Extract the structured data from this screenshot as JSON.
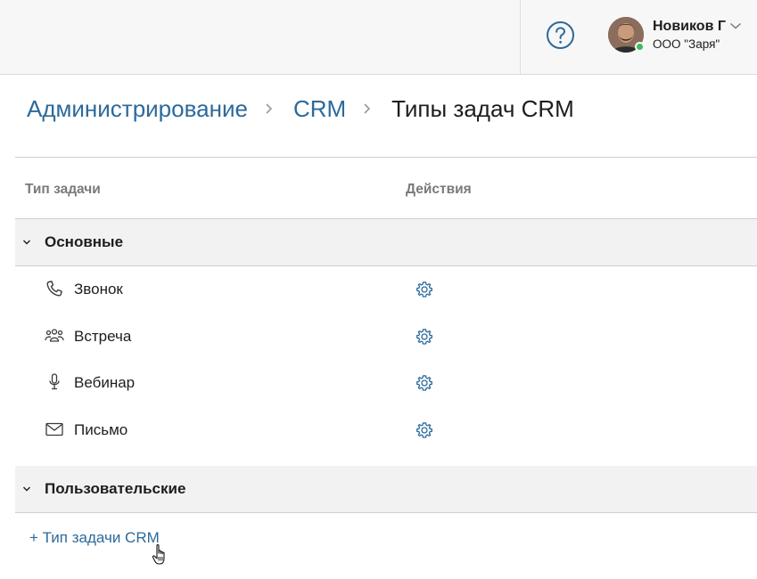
{
  "header": {
    "help_icon": "question-circle-icon",
    "user": {
      "name": "Новиков Г",
      "company": "ООО \"Заря\"",
      "status_color": "#3dbb5a"
    }
  },
  "breadcrumb": {
    "items": [
      "Администрирование",
      "CRM"
    ],
    "current": "Типы задач CRM"
  },
  "table": {
    "columns": [
      "Тип задачи",
      "Действия"
    ],
    "groups": [
      {
        "label": "Основные",
        "items": [
          {
            "icon": "phone-icon",
            "label": "Звонок",
            "action_icon": "gear-icon"
          },
          {
            "icon": "people-icon",
            "label": "Встреча",
            "action_icon": "gear-icon"
          },
          {
            "icon": "microphone-icon",
            "label": "Вебинар",
            "action_icon": "gear-icon"
          },
          {
            "icon": "envelope-icon",
            "label": "Письмо",
            "action_icon": "gear-icon"
          }
        ]
      },
      {
        "label": "Пользовательские",
        "items": []
      }
    ]
  },
  "add_link": "+ Тип задачи CRM",
  "colors": {
    "link": "#2b6a9c",
    "header_bg": "#f7f7f7",
    "group_bg": "#f2f2f2"
  }
}
